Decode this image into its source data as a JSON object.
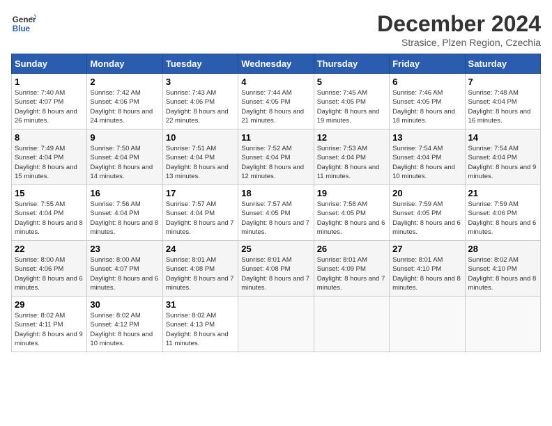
{
  "header": {
    "logo_line1": "General",
    "logo_line2": "Blue",
    "month": "December 2024",
    "location": "Strasice, Plzen Region, Czechia"
  },
  "columns": [
    "Sunday",
    "Monday",
    "Tuesday",
    "Wednesday",
    "Thursday",
    "Friday",
    "Saturday"
  ],
  "weeks": [
    [
      {
        "day": "1",
        "sunrise": "Sunrise: 7:40 AM",
        "sunset": "Sunset: 4:07 PM",
        "daylight": "Daylight: 8 hours and 26 minutes."
      },
      {
        "day": "2",
        "sunrise": "Sunrise: 7:42 AM",
        "sunset": "Sunset: 4:06 PM",
        "daylight": "Daylight: 8 hours and 24 minutes."
      },
      {
        "day": "3",
        "sunrise": "Sunrise: 7:43 AM",
        "sunset": "Sunset: 4:06 PM",
        "daylight": "Daylight: 8 hours and 22 minutes."
      },
      {
        "day": "4",
        "sunrise": "Sunrise: 7:44 AM",
        "sunset": "Sunset: 4:05 PM",
        "daylight": "Daylight: 8 hours and 21 minutes."
      },
      {
        "day": "5",
        "sunrise": "Sunrise: 7:45 AM",
        "sunset": "Sunset: 4:05 PM",
        "daylight": "Daylight: 8 hours and 19 minutes."
      },
      {
        "day": "6",
        "sunrise": "Sunrise: 7:46 AM",
        "sunset": "Sunset: 4:05 PM",
        "daylight": "Daylight: 8 hours and 18 minutes."
      },
      {
        "day": "7",
        "sunrise": "Sunrise: 7:48 AM",
        "sunset": "Sunset: 4:04 PM",
        "daylight": "Daylight: 8 hours and 16 minutes."
      }
    ],
    [
      {
        "day": "8",
        "sunrise": "Sunrise: 7:49 AM",
        "sunset": "Sunset: 4:04 PM",
        "daylight": "Daylight: 8 hours and 15 minutes."
      },
      {
        "day": "9",
        "sunrise": "Sunrise: 7:50 AM",
        "sunset": "Sunset: 4:04 PM",
        "daylight": "Daylight: 8 hours and 14 minutes."
      },
      {
        "day": "10",
        "sunrise": "Sunrise: 7:51 AM",
        "sunset": "Sunset: 4:04 PM",
        "daylight": "Daylight: 8 hours and 13 minutes."
      },
      {
        "day": "11",
        "sunrise": "Sunrise: 7:52 AM",
        "sunset": "Sunset: 4:04 PM",
        "daylight": "Daylight: 8 hours and 12 minutes."
      },
      {
        "day": "12",
        "sunrise": "Sunrise: 7:53 AM",
        "sunset": "Sunset: 4:04 PM",
        "daylight": "Daylight: 8 hours and 11 minutes."
      },
      {
        "day": "13",
        "sunrise": "Sunrise: 7:54 AM",
        "sunset": "Sunset: 4:04 PM",
        "daylight": "Daylight: 8 hours and 10 minutes."
      },
      {
        "day": "14",
        "sunrise": "Sunrise: 7:54 AM",
        "sunset": "Sunset: 4:04 PM",
        "daylight": "Daylight: 8 hours and 9 minutes."
      }
    ],
    [
      {
        "day": "15",
        "sunrise": "Sunrise: 7:55 AM",
        "sunset": "Sunset: 4:04 PM",
        "daylight": "Daylight: 8 hours and 8 minutes."
      },
      {
        "day": "16",
        "sunrise": "Sunrise: 7:56 AM",
        "sunset": "Sunset: 4:04 PM",
        "daylight": "Daylight: 8 hours and 8 minutes."
      },
      {
        "day": "17",
        "sunrise": "Sunrise: 7:57 AM",
        "sunset": "Sunset: 4:04 PM",
        "daylight": "Daylight: 8 hours and 7 minutes."
      },
      {
        "day": "18",
        "sunrise": "Sunrise: 7:57 AM",
        "sunset": "Sunset: 4:05 PM",
        "daylight": "Daylight: 8 hours and 7 minutes."
      },
      {
        "day": "19",
        "sunrise": "Sunrise: 7:58 AM",
        "sunset": "Sunset: 4:05 PM",
        "daylight": "Daylight: 8 hours and 6 minutes."
      },
      {
        "day": "20",
        "sunrise": "Sunrise: 7:59 AM",
        "sunset": "Sunset: 4:05 PM",
        "daylight": "Daylight: 8 hours and 6 minutes."
      },
      {
        "day": "21",
        "sunrise": "Sunrise: 7:59 AM",
        "sunset": "Sunset: 4:06 PM",
        "daylight": "Daylight: 8 hours and 6 minutes."
      }
    ],
    [
      {
        "day": "22",
        "sunrise": "Sunrise: 8:00 AM",
        "sunset": "Sunset: 4:06 PM",
        "daylight": "Daylight: 8 hours and 6 minutes."
      },
      {
        "day": "23",
        "sunrise": "Sunrise: 8:00 AM",
        "sunset": "Sunset: 4:07 PM",
        "daylight": "Daylight: 8 hours and 6 minutes."
      },
      {
        "day": "24",
        "sunrise": "Sunrise: 8:01 AM",
        "sunset": "Sunset: 4:08 PM",
        "daylight": "Daylight: 8 hours and 7 minutes."
      },
      {
        "day": "25",
        "sunrise": "Sunrise: 8:01 AM",
        "sunset": "Sunset: 4:08 PM",
        "daylight": "Daylight: 8 hours and 7 minutes."
      },
      {
        "day": "26",
        "sunrise": "Sunrise: 8:01 AM",
        "sunset": "Sunset: 4:09 PM",
        "daylight": "Daylight: 8 hours and 7 minutes."
      },
      {
        "day": "27",
        "sunrise": "Sunrise: 8:01 AM",
        "sunset": "Sunset: 4:10 PM",
        "daylight": "Daylight: 8 hours and 8 minutes."
      },
      {
        "day": "28",
        "sunrise": "Sunrise: 8:02 AM",
        "sunset": "Sunset: 4:10 PM",
        "daylight": "Daylight: 8 hours and 8 minutes."
      }
    ],
    [
      {
        "day": "29",
        "sunrise": "Sunrise: 8:02 AM",
        "sunset": "Sunset: 4:11 PM",
        "daylight": "Daylight: 8 hours and 9 minutes."
      },
      {
        "day": "30",
        "sunrise": "Sunrise: 8:02 AM",
        "sunset": "Sunset: 4:12 PM",
        "daylight": "Daylight: 8 hours and 10 minutes."
      },
      {
        "day": "31",
        "sunrise": "Sunrise: 8:02 AM",
        "sunset": "Sunset: 4:13 PM",
        "daylight": "Daylight: 8 hours and 11 minutes."
      },
      null,
      null,
      null,
      null
    ]
  ]
}
